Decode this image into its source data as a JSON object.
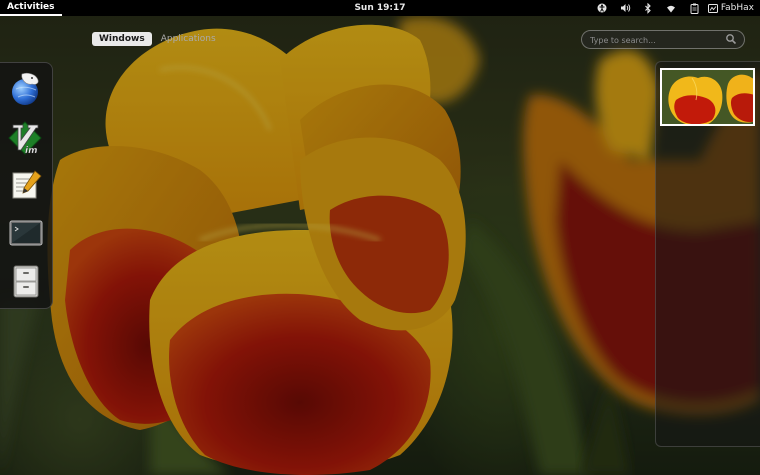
{
  "topbar": {
    "activities_label": "Activities",
    "clock": "Sun 19:17",
    "user_name": "FabHax",
    "tray_icons": [
      "accessibility-icon",
      "volume-icon",
      "bluetooth-icon",
      "wifi-icon",
      "clipboard-icon",
      "user-icon"
    ]
  },
  "overview": {
    "tabs": [
      {
        "label": "Windows",
        "active": true
      },
      {
        "label": "Applications",
        "active": false
      }
    ],
    "search": {
      "placeholder": "Type to search..."
    }
  },
  "dash": {
    "apps": [
      "web-browser-icon",
      "vim-icon",
      "text-editor-icon",
      "terminal-icon",
      "file-manager-icon"
    ]
  },
  "workspaces": {
    "count": 1,
    "active_index": 0
  },
  "colors": {
    "topbar": "#000000",
    "tab_active_bg": "#e9e9e9",
    "tulip_yellow": "#f0b400",
    "tulip_red": "#b8160a"
  }
}
